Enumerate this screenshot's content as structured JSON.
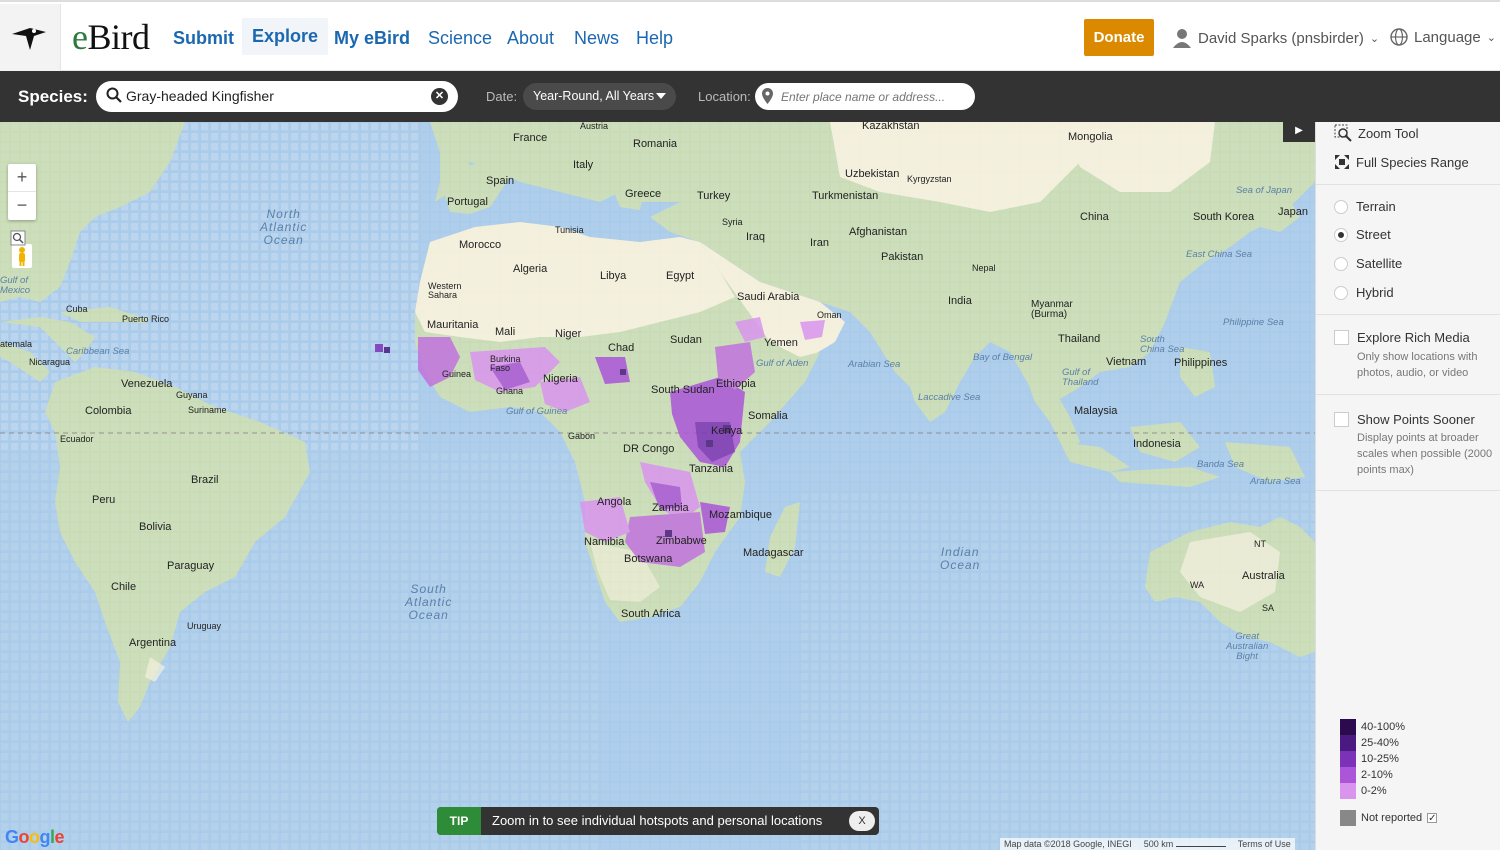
{
  "nav": {
    "brand": "eBird",
    "links": [
      "Submit",
      "Explore",
      "My eBird",
      "Science",
      "About",
      "News",
      "Help"
    ],
    "donate": "Donate",
    "user": "David Sparks (pnsbirder)",
    "language": "Language"
  },
  "species_bar": {
    "label": "Species:",
    "species": "Gray-headed Kingfisher",
    "date_label": "Date:",
    "date_value": "Year-Round, All Years",
    "location_label": "Location:",
    "location_placeholder": "Enter place name or address..."
  },
  "map": {
    "labels": {
      "kazakhstan": "Kazakhstan",
      "mongolia": "Mongolia",
      "france": "France",
      "austria": "Austria",
      "romania": "Romania",
      "spain": "Spain",
      "italy": "Italy",
      "portugal": "Portugal",
      "greece": "Greece",
      "turkey": "Turkey",
      "uzbekistan": "Uzbekistan",
      "kyrgyzstan": "Kyrgyzstan",
      "turkmenistan": "Turkmenistan",
      "china": "China",
      "south_korea": "South Korea",
      "japan": "Japan",
      "syria": "Syria",
      "iraq": "Iraq",
      "iran": "Iran",
      "afghanistan": "Afghanistan",
      "pakistan": "Pakistan",
      "nepal": "Nepal",
      "tunisia": "Tunisia",
      "morocco": "Morocco",
      "algeria": "Algeria",
      "libya": "Libya",
      "egypt": "Egypt",
      "saudi": "Saudi Arabia",
      "india": "India",
      "myanmar": "Myanmar\n(Burma)",
      "w_sahara": "Western\nSahara",
      "oman": "Oman",
      "mauritania": "Mauritania",
      "mali": "Mali",
      "niger": "Niger",
      "chad": "Chad",
      "sudan": "Sudan",
      "yemen": "Yemen",
      "thailand": "Thailand",
      "vietnam": "Vietnam",
      "philippines": "Philippines",
      "burkina": "Burkina\nFaso",
      "guinea": "Guinea",
      "nigeria": "Nigeria",
      "ghana": "Ghana",
      "south_sudan": "South Sudan",
      "ethiopia": "Ethiopia",
      "somalia": "Somalia",
      "malaysia": "Malaysia",
      "gabon": "Gabon",
      "kenya": "Kenya",
      "dr_congo": "DR Congo",
      "tanzania": "Tanzania",
      "indonesia": "Indonesia",
      "angola": "Angola",
      "zambia": "Zambia",
      "mozambique": "Mozambique",
      "namibia": "Namibia",
      "zimbabwe": "Zimbabwe",
      "botswana": "Botswana",
      "madagascar": "Madagascar",
      "south_africa": "South Africa",
      "australia": "Australia",
      "nt": "NT",
      "wa": "WA",
      "sa": "SA",
      "cuba": "Cuba",
      "puerto_rico": "Puerto Rico",
      "nicaragua": "Nicaragua",
      "guatemala": "atemala",
      "venezuela": "Venezuela",
      "guyana": "Guyana",
      "suriname": "Suriname",
      "colombia": "Colombia",
      "ecuador": "Ecuador",
      "brazil": "Brazil",
      "peru": "Peru",
      "bolivia": "Bolivia",
      "paraguay": "Paraguay",
      "chile": "Chile",
      "uruguay": "Uruguay",
      "argentina": "Argentina"
    },
    "oceans": {
      "north_atlantic": "North\nAtlantic\nOcean",
      "south_atlantic": "South\nAtlantic\nOcean",
      "indian": "Indian\nOcean"
    },
    "seas": {
      "caribbean": "Caribbean Sea",
      "gulf_guinea": "Gulf of Guinea",
      "gulf_aden": "Gulf of Aden",
      "arabian": "Arabian Sea",
      "bengal": "Bay of Bengal",
      "laccadive": "Laccadive Sea",
      "east_china": "East China Sea",
      "sea_japan": "Sea of Japan",
      "philippine": "Philippine Sea",
      "south_china": "South\nChina Sea",
      "gulf_thailand": "Gulf of\nThailand",
      "banda": "Banda Sea",
      "arafura": "Arafura Sea",
      "great_bight": "Great\nAustralian\nBight",
      "gulf_mexico": "Gulf of\nMexico"
    },
    "zoom_in": "+",
    "zoom_out": "−",
    "google": "Google",
    "attribution": "Map data ©2018 Google, INEGI",
    "scale": "500 km",
    "terms": "Terms of Use"
  },
  "tip": {
    "badge": "TIP",
    "text": "Zoom in to see individual hotspots and personal locations",
    "close": "X"
  },
  "sidebar": {
    "zoom_tool": "Zoom Tool",
    "full_range": "Full Species Range",
    "map_types": [
      {
        "label": "Terrain",
        "selected": false
      },
      {
        "label": "Street",
        "selected": true
      },
      {
        "label": "Satellite",
        "selected": false
      },
      {
        "label": "Hybrid",
        "selected": false
      }
    ],
    "rich_media": {
      "label": "Explore Rich Media",
      "desc": "Only show locations with photos, audio, or video"
    },
    "points_sooner": {
      "label": "Show Points Sooner",
      "desc": "Display points at broader scales when possible (2000 points max)"
    },
    "legend": [
      {
        "label": "40-100%",
        "color": "#2b0a4e"
      },
      {
        "label": "25-40%",
        "color": "#4b1a80"
      },
      {
        "label": "10-25%",
        "color": "#7b32b8"
      },
      {
        "label": "2-10%",
        "color": "#ab55d8"
      },
      {
        "label": "0-2%",
        "color": "#d995ee"
      }
    ],
    "not_reported": "Not reported"
  },
  "colors": {
    "ocean": "#aacbea",
    "land": "#c9dcb6",
    "desert": "#f3efdc",
    "nav_bg": "#333333",
    "link": "#1c68b0",
    "donate": "#db8a00",
    "tip_badge": "#2e8b38"
  }
}
